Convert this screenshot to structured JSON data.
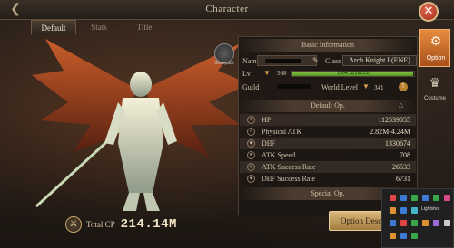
{
  "window": {
    "title": "Character",
    "back_icon": "back-arrow-icon",
    "close_icon": "close-icon"
  },
  "tabs": [
    {
      "label": "Default",
      "active": true
    },
    {
      "label": "Stats",
      "active": false
    },
    {
      "label": "Title",
      "active": false
    }
  ],
  "emblem": {
    "label": "Sheepdot"
  },
  "total_cp": {
    "label": "Total CP",
    "value": "214.14M"
  },
  "basic_info": {
    "header": "Basic Information",
    "name_label": "Name",
    "class_label": "Class",
    "class_value": "Arch Knight I (ENE)",
    "lv_label": "Lv",
    "level": "568",
    "exp_text": "1904.11/1913.91",
    "exp_progress": 0.99,
    "guild_label": "Guild",
    "world_level_label": "World Level",
    "world_level": "341"
  },
  "default_op": {
    "header": "Default Op.",
    "stats": [
      {
        "label": "HP",
        "value": "112539055",
        "icon": "heart-icon"
      },
      {
        "label": "Physical ATK",
        "value": "2.82M-4.24M",
        "icon": "sword-icon"
      },
      {
        "label": "DEF",
        "value": "1330674",
        "icon": "shield-icon"
      },
      {
        "label": "ATK Speed",
        "value": "708",
        "icon": "speed-icon"
      },
      {
        "label": "ATK Success Rate",
        "value": "26533",
        "icon": "target-icon"
      },
      {
        "label": "DEF Success Rate",
        "value": "6731",
        "icon": "guard-icon"
      }
    ]
  },
  "special_op": {
    "header": "Special Op."
  },
  "option_desc_button": "Option Descr",
  "side_menu": [
    {
      "label": "Option",
      "icon": "option-icon",
      "active": true
    },
    {
      "label": "Costume",
      "icon": "costume-icon",
      "active": false
    }
  ],
  "tray": {
    "label": "Lightshot"
  },
  "colors": {
    "accent": "#e58b3e",
    "exp_bar": "#8fd14b",
    "button": "#d9b77a"
  }
}
